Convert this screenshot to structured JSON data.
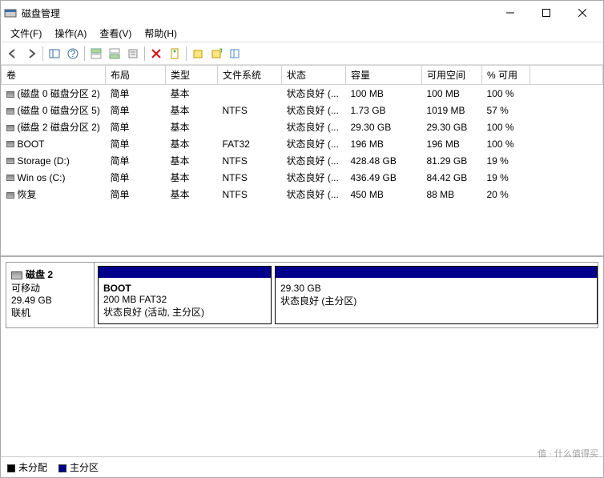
{
  "window": {
    "title": "磁盘管理"
  },
  "menus": {
    "file": "文件(F)",
    "action": "操作(A)",
    "view": "查看(V)",
    "help": "帮助(H)"
  },
  "columns": {
    "volume": "卷",
    "layout": "布局",
    "type": "类型",
    "fs": "文件系统",
    "status": "状态",
    "capacity": "容量",
    "free": "可用空间",
    "pctfree": "% 可用"
  },
  "volumes": [
    {
      "name": "(磁盘 0 磁盘分区 2)",
      "layout": "简单",
      "type": "基本",
      "fs": "",
      "status": "状态良好 (...",
      "capacity": "100 MB",
      "free": "100 MB",
      "pct": "100 %"
    },
    {
      "name": "(磁盘 0 磁盘分区 5)",
      "layout": "简单",
      "type": "基本",
      "fs": "NTFS",
      "status": "状态良好 (...",
      "capacity": "1.73 GB",
      "free": "1019 MB",
      "pct": "57 %"
    },
    {
      "name": "(磁盘 2 磁盘分区 2)",
      "layout": "简单",
      "type": "基本",
      "fs": "",
      "status": "状态良好 (...",
      "capacity": "29.30 GB",
      "free": "29.30 GB",
      "pct": "100 %"
    },
    {
      "name": "BOOT",
      "layout": "简单",
      "type": "基本",
      "fs": "FAT32",
      "status": "状态良好 (...",
      "capacity": "196 MB",
      "free": "196 MB",
      "pct": "100 %"
    },
    {
      "name": "Storage (D:)",
      "layout": "简单",
      "type": "基本",
      "fs": "NTFS",
      "status": "状态良好 (...",
      "capacity": "428.48 GB",
      "free": "81.29 GB",
      "pct": "19 %"
    },
    {
      "name": "Win os  (C:)",
      "layout": "简单",
      "type": "基本",
      "fs": "NTFS",
      "status": "状态良好 (...",
      "capacity": "436.49 GB",
      "free": "84.42 GB",
      "pct": "19 %"
    },
    {
      "name": "恢复",
      "layout": "简单",
      "type": "基本",
      "fs": "NTFS",
      "status": "状态良好 (...",
      "capacity": "450 MB",
      "free": "88 MB",
      "pct": "20 %"
    }
  ],
  "disk": {
    "name": "磁盘 2",
    "media": "可移动",
    "size": "29.49 GB",
    "status": "联机",
    "partitions": [
      {
        "name": "BOOT",
        "sub": "200 MB FAT32",
        "state": "状态良好 (活动, 主分区)",
        "widthpct": 35
      },
      {
        "name": "",
        "sub": "29.30 GB",
        "state": "状态良好 (主分区)",
        "widthpct": 65
      }
    ]
  },
  "legend": {
    "unalloc": "未分配",
    "primary": "主分区"
  },
  "watermark": "值 · 什么值得买"
}
